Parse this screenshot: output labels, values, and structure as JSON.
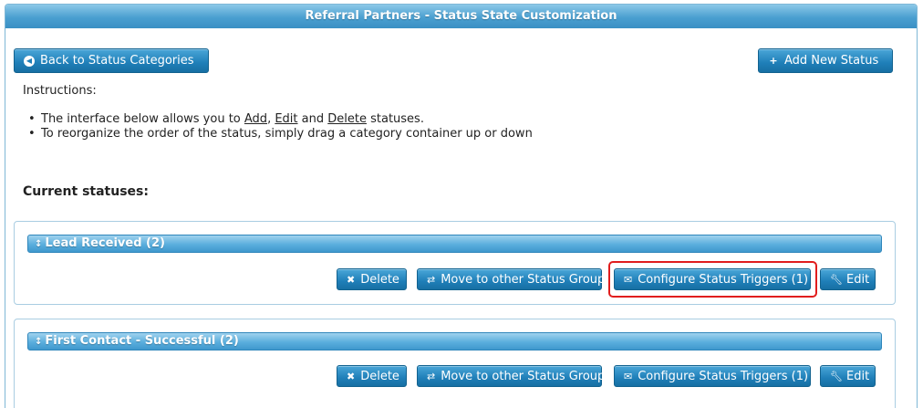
{
  "window": {
    "title": "Referral Partners - Status State Customization"
  },
  "toolbar": {
    "back_label": "Back to Status Categories",
    "add_label": "Add New Status"
  },
  "instructions": {
    "heading": "Instructions:",
    "line1_pre": "The interface below allows you to ",
    "line1_add": "Add",
    "line1_comma": ", ",
    "line1_edit": "Edit",
    "line1_and": " and ",
    "line1_delete": "Delete",
    "line1_post": " statuses.",
    "line2": "To reorganize the order of the status, simply drag a category container up or down"
  },
  "current_heading": "Current statuses:",
  "statuses": [
    {
      "title": "Lead Received (2)",
      "delete_label": "Delete",
      "move_label": "Move to other Status Group",
      "triggers_label": "Configure Status Triggers (1)",
      "edit_label": "Edit",
      "triggers_highlighted": true
    },
    {
      "title": "First Contact - Successful (2)",
      "delete_label": "Delete",
      "move_label": "Move to other Status Group",
      "triggers_label": "Configure Status Triggers (1)",
      "edit_label": "Edit",
      "triggers_highlighted": false
    }
  ],
  "colors": {
    "accent": "#1f7fb8",
    "header": "#4a9fd0",
    "highlight": "#e11d1d"
  },
  "icons": {
    "back": "circle-arrow-left-icon",
    "add": "plus-icon",
    "drag": "updown-arrow-icon",
    "delete": "x-icon",
    "move": "swap-arrows-icon",
    "triggers": "envelope-icon",
    "edit": "wrench-icon"
  }
}
